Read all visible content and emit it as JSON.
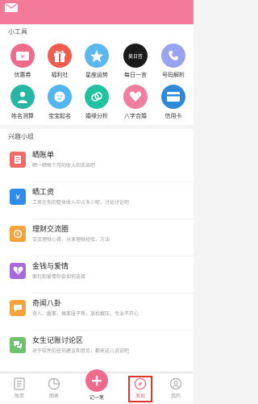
{
  "tools": {
    "title": "小工具",
    "items": [
      {
        "label": "优惠券",
        "icon": "coupon-icon",
        "color": "#ee6b8e"
      },
      {
        "label": "福利社",
        "icon": "gift-icon",
        "color": "#ef5d4e"
      },
      {
        "label": "星座运势",
        "icon": "star-icon",
        "color": "#5bb8ee"
      },
      {
        "label": "每日一言",
        "icon": "daily-quote-icon",
        "color": "#1a1a1a",
        "badge": "美日签"
      },
      {
        "label": "号码解析",
        "icon": "phone-icon",
        "color": "#9aa3f0"
      },
      {
        "label": "姓名测算",
        "icon": "person-icon",
        "color": "#28b6a4"
      },
      {
        "label": "宝宝起名",
        "icon": "baby-icon",
        "color": "#52b7f0"
      },
      {
        "label": "婚缘分析",
        "icon": "ring-icon",
        "color": "#20c2a0"
      },
      {
        "label": "八字合婚",
        "icon": "bazi-icon",
        "color": "#f07f9f"
      },
      {
        "label": "信用卡",
        "icon": "credit-card-icon",
        "color": "#2e89d8"
      }
    ]
  },
  "groups": {
    "title": "兴趣小组",
    "items": [
      {
        "title": "晒账单",
        "subtitle": "晒一晒每个月的收入和支出吧",
        "icon": "bill-icon",
        "color": "#f06a6a"
      },
      {
        "title": "晒工资",
        "subtitle": "工资在你的整体收入中占多少呢，讨论讨论吧",
        "icon": "salary-icon",
        "color": "#2f8ce8"
      },
      {
        "title": "理财交流圈",
        "subtitle": "交流理财心得，分享理财经验、方法",
        "icon": "finance-icon",
        "color": "#f6a33c"
      },
      {
        "title": "金钱与爱情",
        "subtitle": "面包和爱情你会如何选择",
        "icon": "broken-heart-icon",
        "color": "#a66bd8"
      },
      {
        "title": "奇闻八卦",
        "subtitle": "奇人、趣事、搞笑段子等，放松解压，专治不开心",
        "icon": "chat-icon",
        "color": "#f6a33c"
      },
      {
        "title": "女生记账讨论区",
        "subtitle": "对于软件的任何建议和意见，都来这儿说说吧",
        "icon": "discussion-icon",
        "color": "#6fc36f"
      }
    ]
  },
  "tabbar": {
    "tabs": [
      {
        "label": "账单",
        "icon": "bill-tab-icon"
      },
      {
        "label": "图表",
        "icon": "chart-tab-icon"
      },
      {
        "label": "记一笔",
        "icon": "plus-icon"
      },
      {
        "label": "发现",
        "icon": "compass-tab-icon"
      },
      {
        "label": "我的",
        "icon": "profile-tab-icon"
      }
    ]
  },
  "colors": {
    "header": "#f37a99",
    "accent": "#ee6b8e",
    "highlight": "#e3342f"
  }
}
